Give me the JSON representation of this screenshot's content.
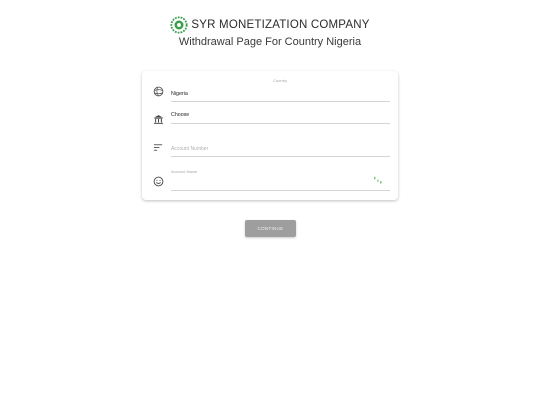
{
  "header": {
    "company_name": "SYR MONETIZATION COMPANY",
    "subtitle": "Withdrawal Page For Country Nigeria"
  },
  "form": {
    "country": {
      "label": "Country",
      "value": "Nigeria",
      "icon": "globe-icon"
    },
    "bank": {
      "value": "Choose",
      "icon": "bank-icon"
    },
    "account_number": {
      "placeholder": "Account Number",
      "icon": "sort-lines-icon"
    },
    "account_name": {
      "label": "Account Name",
      "icon": "smiley-icon",
      "status_icon": "loading-spinner-icon"
    }
  },
  "continue_button": {
    "label": "CONTINUE"
  },
  "colors": {
    "logo_green": "#3a9e4a",
    "button_grey": "#9e9e9e",
    "spinner_green": "#4caf50"
  }
}
